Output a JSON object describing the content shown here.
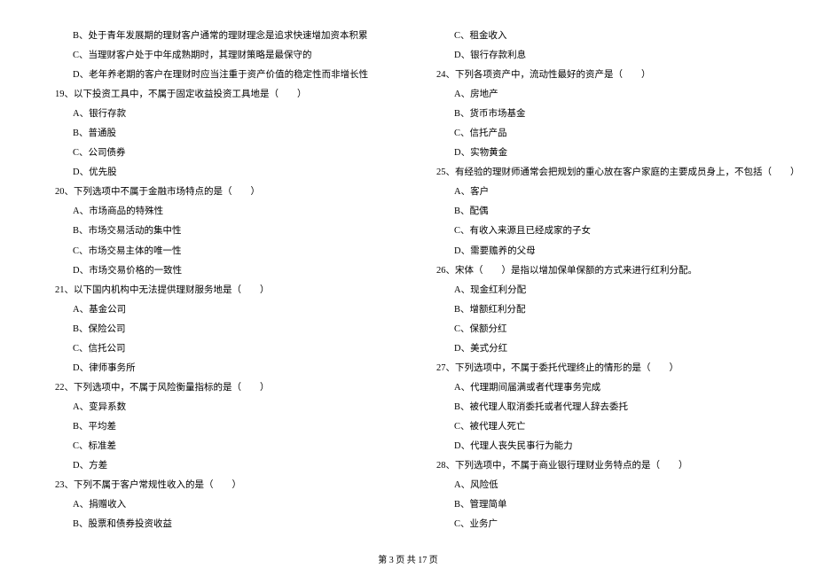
{
  "left": [
    {
      "cls": "opt",
      "t": "B、处于青年发展期的理财客户通常的理财理念是追求快速增加资本积累"
    },
    {
      "cls": "opt",
      "t": "C、当理财客户处于中年成熟期时，其理财策略是最保守的"
    },
    {
      "cls": "opt",
      "t": "D、老年养老期的客户在理财时应当注重于资产价值的稳定性而非增长性"
    },
    {
      "cls": "q",
      "t": "19、以下投资工具中，不属于固定收益投资工具地是（　　）"
    },
    {
      "cls": "opt",
      "t": "A、银行存款"
    },
    {
      "cls": "opt",
      "t": "B、普通股"
    },
    {
      "cls": "opt",
      "t": "C、公司债券"
    },
    {
      "cls": "opt",
      "t": "D、优先股"
    },
    {
      "cls": "q",
      "t": "20、下列选项中不属于金融市场特点的是（　　）"
    },
    {
      "cls": "opt",
      "t": "A、市场商品的特殊性"
    },
    {
      "cls": "opt",
      "t": "B、市场交易活动的集中性"
    },
    {
      "cls": "opt",
      "t": "C、市场交易主体的唯一性"
    },
    {
      "cls": "opt",
      "t": "D、市场交易价格的一致性"
    },
    {
      "cls": "q",
      "t": "21、以下国内机构中无法提供理财服务地是（　　）"
    },
    {
      "cls": "opt",
      "t": "A、基金公司"
    },
    {
      "cls": "opt",
      "t": "B、保险公司"
    },
    {
      "cls": "opt",
      "t": "C、信托公司"
    },
    {
      "cls": "opt",
      "t": "D、律师事务所"
    },
    {
      "cls": "q",
      "t": "22、下列选项中，不属于风险衡量指标的是（　　）"
    },
    {
      "cls": "opt",
      "t": "A、变异系数"
    },
    {
      "cls": "opt",
      "t": "B、平均差"
    },
    {
      "cls": "opt",
      "t": "C、标准差"
    },
    {
      "cls": "opt",
      "t": "D、方差"
    },
    {
      "cls": "q",
      "t": "23、下列不属于客户常规性收入的是（　　）"
    },
    {
      "cls": "opt",
      "t": "A、捐赠收入"
    },
    {
      "cls": "opt",
      "t": "B、股票和债券投资收益"
    }
  ],
  "right": [
    {
      "cls": "opt",
      "t": "C、租金收入"
    },
    {
      "cls": "opt",
      "t": "D、银行存款利息"
    },
    {
      "cls": "q",
      "t": "24、下列各项资产中，流动性最好的资产是（　　）"
    },
    {
      "cls": "opt",
      "t": "A、房地产"
    },
    {
      "cls": "opt",
      "t": "B、货币市场基金"
    },
    {
      "cls": "opt",
      "t": "C、信托产品"
    },
    {
      "cls": "opt",
      "t": "D、实物黄金"
    },
    {
      "cls": "q",
      "t": "25、有经验的理财师通常会把规划的重心放在客户家庭的主要成员身上，不包括（　　）"
    },
    {
      "cls": "opt",
      "t": "A、客户"
    },
    {
      "cls": "opt",
      "t": "B、配偶"
    },
    {
      "cls": "opt",
      "t": "C、有收入来源且已经成家的子女"
    },
    {
      "cls": "opt",
      "t": "D、需要赡养的父母"
    },
    {
      "cls": "q",
      "t": "26、宋体（　　）是指以增加保单保额的方式来进行红利分配。"
    },
    {
      "cls": "opt",
      "t": "A、现金红利分配"
    },
    {
      "cls": "opt",
      "t": "B、增额红利分配"
    },
    {
      "cls": "opt",
      "t": "C、保额分红"
    },
    {
      "cls": "opt",
      "t": "D、美式分红"
    },
    {
      "cls": "q",
      "t": "27、下列选项中，不属于委托代理终止的情形的是（　　）"
    },
    {
      "cls": "opt",
      "t": "A、代理期间届满或者代理事务完成"
    },
    {
      "cls": "opt",
      "t": "B、被代理人取消委托或者代理人辞去委托"
    },
    {
      "cls": "opt",
      "t": "C、被代理人死亡"
    },
    {
      "cls": "opt",
      "t": "D、代理人丧失民事行为能力"
    },
    {
      "cls": "q",
      "t": "28、下列选项中，不属于商业银行理财业务特点的是（　　）"
    },
    {
      "cls": "opt",
      "t": "A、风险低"
    },
    {
      "cls": "opt",
      "t": "B、管理简单"
    },
    {
      "cls": "opt",
      "t": "C、业务广"
    }
  ],
  "footer": "第 3 页 共 17 页"
}
